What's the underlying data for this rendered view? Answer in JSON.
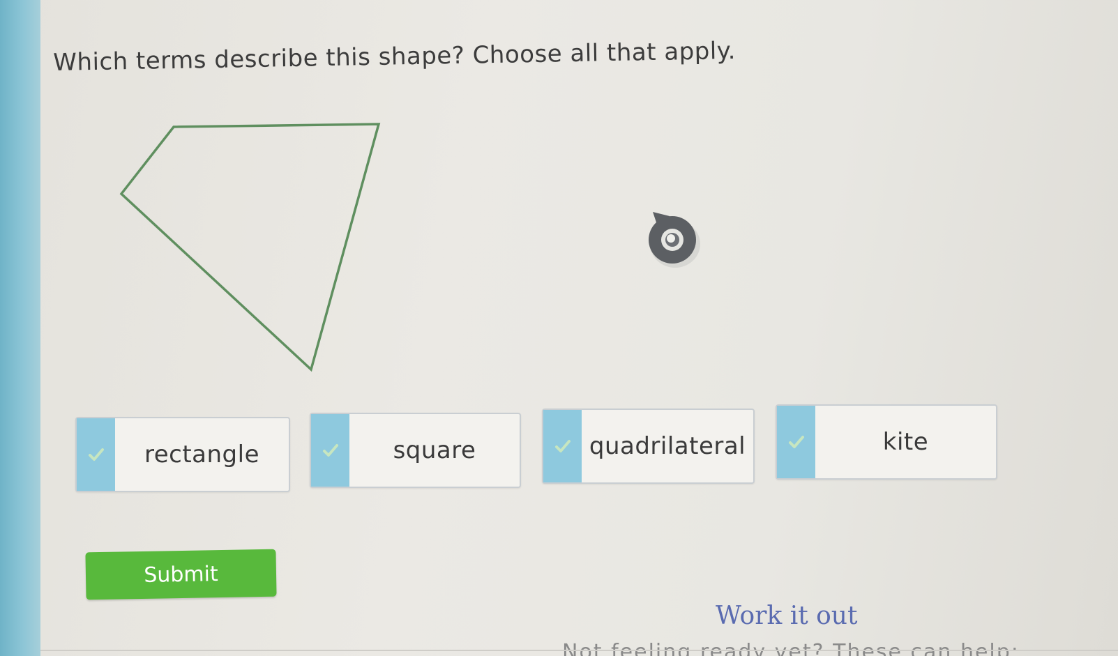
{
  "question": {
    "text": "Which terms describe this shape? Choose all that apply."
  },
  "choices": [
    {
      "label": "rectangle",
      "selected": false
    },
    {
      "label": "square",
      "selected": false
    },
    {
      "label": "quadrilateral",
      "selected": false
    },
    {
      "label": "kite",
      "selected": false
    }
  ],
  "submit": {
    "label": "Submit"
  },
  "help": {
    "work_it_out": "Work it out",
    "not_ready": "Not feeling ready yet? These can help:"
  },
  "colors": {
    "accent_green": "#58b93c",
    "choice_tab": "#8ec9de",
    "shape_stroke": "#5f8f5f",
    "link": "#5a6bb0"
  },
  "icons": {
    "choice_check": "check-icon",
    "pointer": "pointer-cursor-icon"
  }
}
